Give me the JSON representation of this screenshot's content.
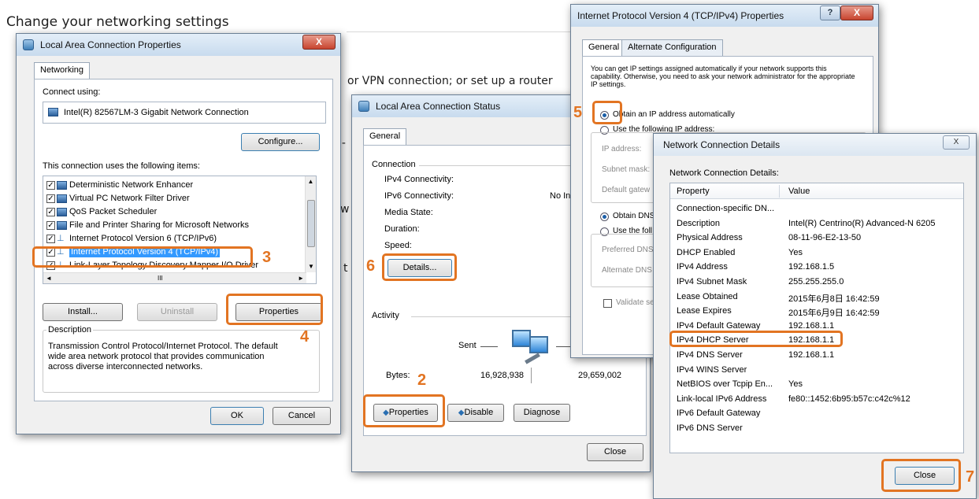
{
  "background": {
    "heading": "Change your networking settings",
    "line1": "or VPN connection; or set up a router",
    "frag1": "l-",
    "frag2": "w",
    "frag3": "t"
  },
  "accent": "#e27422",
  "lac_props": {
    "title": "Local Area Connection Properties",
    "close_label": "X",
    "tab": "Networking",
    "connect_using": "Connect using:",
    "adapter": "Intel(R) 82567LM-3 Gigabit Network Connection",
    "configure": "Configure...",
    "items_label": "This connection uses the following items:",
    "items": [
      {
        "label": "Deterministic Network Enhancer",
        "checked": true
      },
      {
        "label": "Virtual PC Network Filter Driver",
        "checked": true
      },
      {
        "label": "QoS Packet Scheduler",
        "checked": true
      },
      {
        "label": "File and Printer Sharing for Microsoft Networks",
        "checked": true
      },
      {
        "label": "Internet Protocol Version 6 (TCP/IPv6)",
        "checked": true
      },
      {
        "label": "Internet Protocol Version 4 (TCP/IPv4)",
        "checked": true,
        "selected": true
      },
      {
        "label": "Link-Layer Topology Discovery Mapper I/O Driver",
        "checked": true
      }
    ],
    "scroll_mid": "III",
    "install": "Install...",
    "uninstall": "Uninstall",
    "properties": "Properties",
    "description_label": "Description",
    "description": "Transmission Control Protocol/Internet Protocol. The default wide area network protocol that provides communication across diverse interconnected networks.",
    "ok": "OK",
    "cancel": "Cancel"
  },
  "status": {
    "title": "Local Area Connection Status",
    "tab": "General",
    "connection_label": "Connection",
    "rows": [
      {
        "label": "IPv4 Connectivity:",
        "value": ""
      },
      {
        "label": "IPv6 Connectivity:",
        "value": "No In"
      },
      {
        "label": "Media State:",
        "value": ""
      },
      {
        "label": "Duration:",
        "value": ""
      },
      {
        "label": "Speed:",
        "value": ""
      }
    ],
    "details": "Details...",
    "activity_label": "Activity",
    "sent": "Sent",
    "bytes_label": "Bytes:",
    "bytes_sent": "16,928,938",
    "bytes_received": "29,659,002",
    "properties": "Properties",
    "disable": "Disable",
    "diagnose": "Diagnose",
    "close": "Close"
  },
  "ipv4": {
    "title": "Internet Protocol Version 4 (TCP/IPv4) Properties",
    "help_label": "?",
    "close_label": "X",
    "tab_general": "General",
    "tab_alternate": "Alternate Configuration",
    "intro": "You can get IP settings assigned automatically if your network supports this capability. Otherwise, you need to ask your network administrator for the appropriate IP settings.",
    "obtain_ip": "Obtain an IP address automatically",
    "use_ip": "Use the following IP address:",
    "ip_address": "IP address:",
    "subnet": "Subnet mask:",
    "gateway": "Default gatew",
    "obtain_dns": "Obtain DNS",
    "use_dns": "Use the foll",
    "preferred_dns": "Preferred DNS",
    "alternate_dns": "Alternate DNS",
    "validate": "Validate se"
  },
  "details": {
    "title": "Network Connection Details",
    "close_label": "X",
    "heading": "Network Connection Details:",
    "col_property": "Property",
    "col_value": "Value",
    "rows": [
      {
        "property": "Connection-specific DN...",
        "value": ""
      },
      {
        "property": "Description",
        "value": "Intel(R) Centrino(R) Advanced-N 6205"
      },
      {
        "property": "Physical Address",
        "value": "08-11-96-E2-13-50"
      },
      {
        "property": "DHCP Enabled",
        "value": "Yes"
      },
      {
        "property": "IPv4 Address",
        "value": "192.168.1.5"
      },
      {
        "property": "IPv4 Subnet Mask",
        "value": "255.255.255.0"
      },
      {
        "property": "Lease Obtained",
        "value": "2015年6月8日 16:42:59"
      },
      {
        "property": "Lease Expires",
        "value": "2015年6月9日 16:42:59"
      },
      {
        "property": "IPv4 Default Gateway",
        "value": "192.168.1.1"
      },
      {
        "property": "IPv4 DHCP Server",
        "value": "192.168.1.1"
      },
      {
        "property": "IPv4 DNS Server",
        "value": "192.168.1.1"
      },
      {
        "property": "IPv4 WINS Server",
        "value": ""
      },
      {
        "property": "NetBIOS over Tcpip En...",
        "value": "Yes"
      },
      {
        "property": "Link-local IPv6 Address",
        "value": "fe80::1452:6b95:b57c:c42c%12"
      },
      {
        "property": "IPv6 Default Gateway",
        "value": ""
      },
      {
        "property": "IPv6 DNS Server",
        "value": ""
      }
    ],
    "close": "Close"
  },
  "steps": {
    "s2": "2",
    "s3": "3",
    "s4": "4",
    "s5": "5",
    "s6": "6",
    "s7": "7"
  }
}
